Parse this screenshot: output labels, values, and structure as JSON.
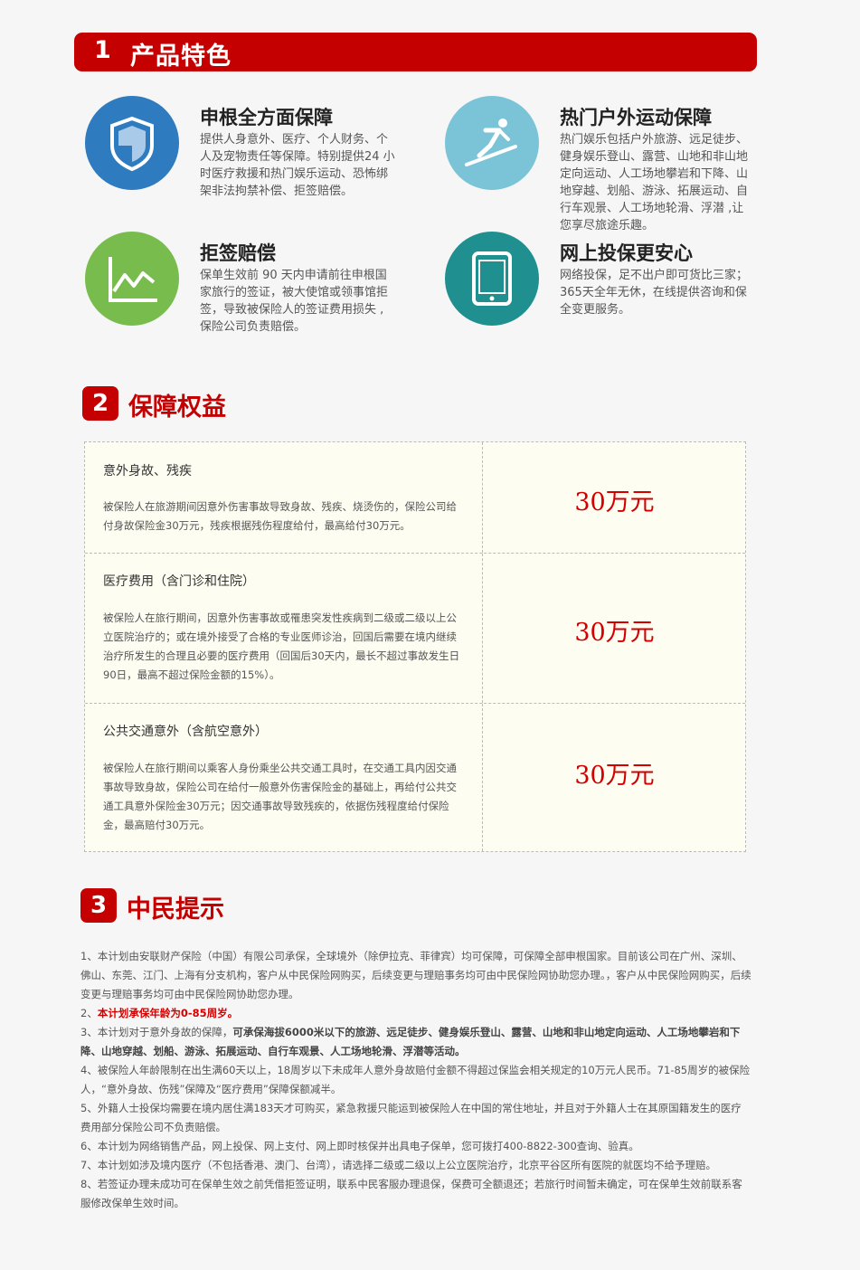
{
  "section1": {
    "number": "1",
    "title": "产品特色",
    "features": [
      {
        "icon": "shield-icon",
        "color": "#2e7bbf",
        "title": "申根全方面保障",
        "desc": "提供人身意外、医疗、个人财务、个人及宠物责任等保障。特别提供24 小时医疗救援和热门娱乐运动、恐怖绑架非法拘禁补偿、拒签赔偿。"
      },
      {
        "icon": "skier-icon",
        "color": "#7bc4d8",
        "title": "热门户外运动保障",
        "desc": "热门娱乐包括户外旅游、远足徒步、健身娱乐登山、露营、山地和非山地定向运动、人工场地攀岩和下降、山地穿越、划船、游泳、拓展运动、自行车观景、人工场地轮滑、浮潜 ,让您享尽旅途乐趣。"
      },
      {
        "icon": "chart-icon",
        "color": "#79bc4e",
        "title": "拒签赔偿",
        "desc": "保单生效前 90 天内申请前往申根国家旅行的签证，被大使馆或领事馆拒签，导致被保险人的签证费用损失 ,保险公司负责赔偿。"
      },
      {
        "icon": "tablet-icon",
        "color": "#1f8f8f",
        "title": "网上投保更安心",
        "desc": "网络投保，足不出户即可货比三家；365天全年无休，在线提供咨询和保全变更服务。"
      }
    ]
  },
  "section2": {
    "number": "2",
    "title": "保障权益",
    "rows": [
      {
        "title": "意外身故、残疾",
        "desc": "被保险人在旅游期间因意外伤害事故导致身故、残疾、烧烫伤的，保险公司给付身故保险金30万元，残疾根据残伤程度给付，最高给付30万元。",
        "amount": "30万元"
      },
      {
        "title": "医疗费用（含门诊和住院）",
        "desc": "被保险人在旅行期间，因意外伤害事故或罹患突发性疾病到二级或二级以上公立医院治疗的；或在境外接受了合格的专业医师诊治，回国后需要在境内继续治疗所发生的合理且必要的医疗费用（回国后30天内，最长不超过事故发生日90日，最高不超过保险金额的15%）。",
        "amount": "30万元"
      },
      {
        "title": "公共交通意外（含航空意外）",
        "desc": "被保险人在旅行期间以乘客人身份乘坐公共交通工具时，在交通工具内因交通事故导致身故，保险公司在给付一般意外伤害保险金的基础上，再给付公共交通工具意外保险金30万元；因交通事故导致残疾的，依据伤残程度给付保险金，最高赔付30万元。",
        "amount": "30万元"
      }
    ]
  },
  "section3": {
    "number": "3",
    "title": "中民提示",
    "notes": {
      "n1": "1、本计划由安联财产保险（中国）有限公司承保，全球境外（除伊拉克、菲律宾）均可保障，可保障全部申根国家。目前该公司在广州、深圳、佛山、东莞、江门、上海有分支机构，客户从中民保险网购买，后续变更与理赔事务均可由中民保险网协助您办理。，客户从中民保险网购买，后续变更与理赔事务均可由中民保险网协助您办理。",
      "n2_prefix": "2、",
      "n2_red": "本计划承保年龄为0-85周岁。",
      "n3_prefix": "3、本计划对于意外身故的保障，",
      "n3_bold": "可承保海拔6000米以下的旅游、远足徒步、健身娱乐登山、露营、山地和非山地定向运动、人工场地攀岩和下降、山地穿越、划船、游泳、拓展运动、自行车观景、人工场地轮滑、浮潜等活动。",
      "n4": "4、被保险人年龄限制在出生满60天以上，18周岁以下未成年人意外身故赔付金额不得超过保监会相关规定的10万元人民币。71-85周岁的被保险人，“意外身故、伤残”保障及“医疗费用”保障保额减半。",
      "n5": "5、外籍人士投保均需要在境内居住满183天才可购买，紧急救援只能运到被保险人在中国的常住地址，并且对于外籍人士在其原国籍发生的医疗费用部分保险公司不负责赔偿。",
      "n6": "6、本计划为网络销售产品，网上投保、网上支付、网上即时核保并出具电子保单，您可拨打400-8822-300查询、验真。",
      "n7": "7、本计划如涉及境内医疗（不包括香港、澳门、台湾），请选择二级或二级以上公立医院治疗，北京平谷区所有医院的就医均不给予理赔。",
      "n8": "8、若签证办理未成功可在保单生效之前凭借拒签证明，联系中民客服办理退保，保费可全额退还；若旅行时间暂未确定，可在保单生效前联系客服修改保单生效时间。"
    }
  }
}
